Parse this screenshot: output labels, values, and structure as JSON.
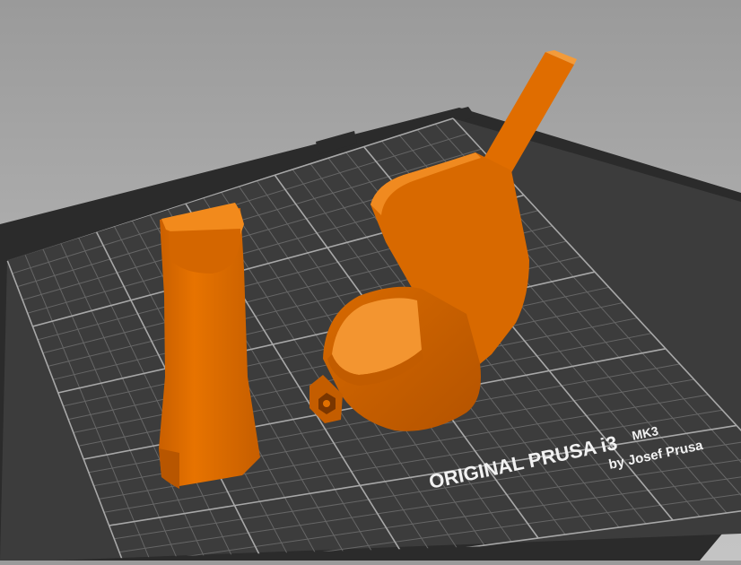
{
  "viewport": {
    "label": "3D build plate preview"
  },
  "bed": {
    "model": "ORIGINAL PRUSA i3",
    "variant": "MK3",
    "author": "by Josef Prusa",
    "color_surface": "#3c3c3c",
    "color_grid": "#8a8a8a",
    "color_frame": "#2b2b2b"
  },
  "objects": [
    {
      "name": "Handle grip part",
      "color": "#e06d00"
    },
    {
      "name": "Cup with arm part",
      "color": "#e06d00"
    }
  ]
}
